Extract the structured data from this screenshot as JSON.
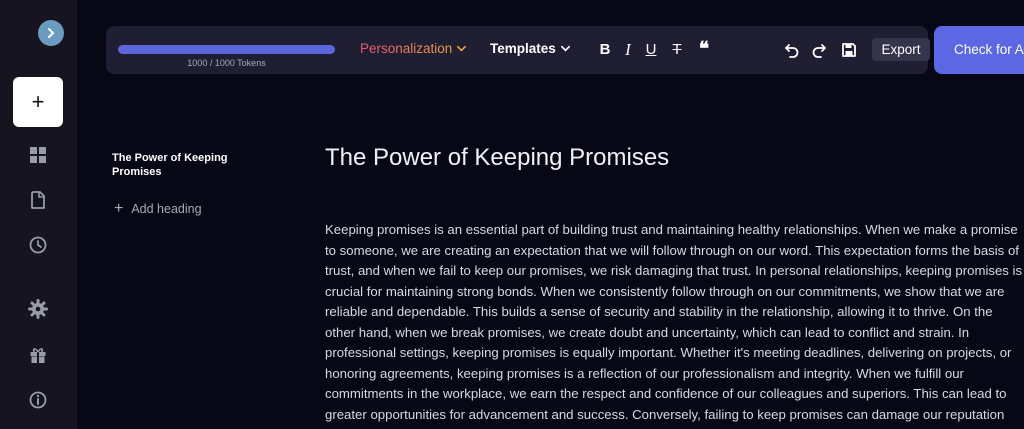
{
  "sidebar": {
    "collapse_icon": "chevron-right-icon",
    "new_label": "+",
    "icons": [
      "dashboard-icon",
      "document-icon",
      "history-icon",
      "settings-icon",
      "gift-icon",
      "info-icon"
    ]
  },
  "toolbar": {
    "tokens_label": "1000 / 1000 Tokens",
    "tokens_used": 1000,
    "tokens_total": 1000,
    "personalization_label": "Personalization",
    "templates_label": "Templates",
    "bold_label": "B",
    "italic_label": "I",
    "underline_label": "U",
    "strike_label": "T",
    "quote_label": "❝",
    "export_label": "Export",
    "check_label": "Check for AI"
  },
  "outline": {
    "title": "The Power of Keeping Promises",
    "add_heading_label": "Add heading"
  },
  "document": {
    "title": "The Power of Keeping Promises",
    "lines": [
      "Keeping promises is an essential part of building trust and maintaining healthy relationships. When we make a promise",
      "to someone, we are creating an expectation that we will follow through on our word. This expectation forms the basis of",
      "trust, and when we fail to keep our promises, we risk damaging that trust. In personal relationships, keeping promises is",
      "crucial for maintaining strong bonds. When we consistently follow through on our commitments, we show that we are",
      "reliable and dependable. This builds a sense of security and stability in the relationship, allowing it to thrive. On the",
      "other hand, when we break promises, we create doubt and uncertainty, which can lead to conflict and strain. In",
      "professional settings, keeping promises is equally important. Whether it's meeting deadlines, delivering on projects, or",
      "honoring agreements, keeping promises is a reflection of our professionalism and integrity. When we fulfill our",
      "commitments in the workplace, we earn the respect and confidence of our colleagues and superiors. This can lead to",
      "greater opportunities for advancement and success. Conversely, failing to keep promises can damage our reputation"
    ]
  },
  "colors": {
    "background": "#080716",
    "sidebar": "#15141f",
    "toolbar": "#1f1e33",
    "accent": "#5b67e3",
    "personalization_from": "#e9557c",
    "personalization_to": "#f2a13b"
  }
}
